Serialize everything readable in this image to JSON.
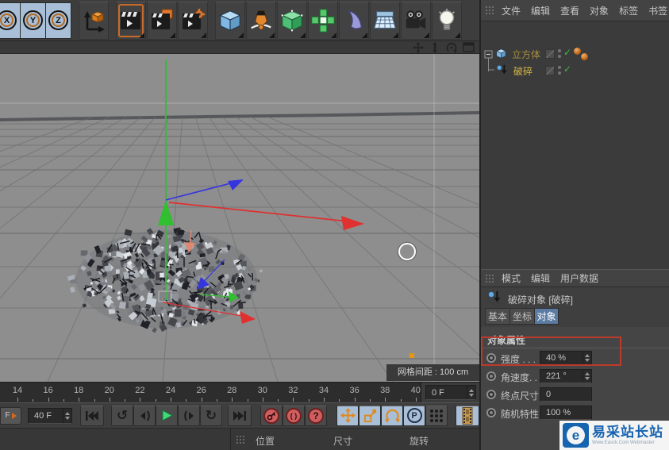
{
  "toolbar": {
    "axis_locks": [
      "X",
      "Y",
      "Z"
    ],
    "icons": [
      "coordinate-system",
      "render-view",
      "render-picture-viewer",
      "render-settings",
      "add-cube",
      "add-spline",
      "add-generator",
      "add-mograph",
      "add-deformer",
      "add-environment",
      "add-camera",
      "add-light"
    ]
  },
  "viewport": {
    "controls": [
      "camera-pan",
      "camera-zoom",
      "camera-rotate",
      "view-toggle"
    ],
    "grid_label": "网格间距 : 100 cm",
    "axis_colors": {
      "x": "#e03030",
      "y": "#2fbf2f",
      "z": "#3535e0"
    }
  },
  "scene": {
    "debris": {
      "count": 380,
      "slivers": 90,
      "seed": 7,
      "palette": [
        "#202228",
        "#33353b",
        "#45474d",
        "#55575d",
        "#66686e",
        "#7a7c82",
        "#8f9298",
        "#aab0b6",
        "#c8cdd3",
        "#e2e6ea"
      ]
    }
  },
  "timeline": {
    "tick_labels": [
      "14",
      "16",
      "18",
      "20",
      "22",
      "24",
      "26",
      "28",
      "30",
      "32",
      "34",
      "36",
      "38",
      "40"
    ],
    "frame_display": "0 F",
    "current_frame": "40 F",
    "partial_label": "F"
  },
  "transport": {
    "icons": [
      "goto-start",
      "prev-key",
      "prev-frame",
      "play",
      "next-frame",
      "next-key",
      "goto-end",
      "record-key",
      "autokey",
      "keyframe-question",
      "move-tool",
      "scale-tool",
      "rotate-tool",
      "coordinate-p",
      "keyframe-dots",
      "filmstrip"
    ],
    "paren_glyph": "( )",
    "question_glyph": "?",
    "p_glyph": "P"
  },
  "coordinate_bar": {
    "position_label": "位置",
    "size_label": "尺寸",
    "rotation_label": "旋转"
  },
  "object_manager": {
    "menu": [
      "文件",
      "编辑",
      "查看",
      "对象",
      "标签",
      "书签"
    ],
    "objects": [
      {
        "name": "立方体",
        "enabled": true,
        "tags": 2
      },
      {
        "name": "破碎",
        "enabled": true,
        "child": true
      }
    ]
  },
  "attribute_manager": {
    "menu": [
      "模式",
      "编辑",
      "用户数据"
    ],
    "object_title": "破碎对象 [破碎]",
    "tabs": [
      "基本",
      "坐标",
      "对象"
    ],
    "active_tab": "对象",
    "section_title": "对象属性",
    "properties": [
      {
        "label": "强度 . . .",
        "value": "40 %",
        "stepper": true
      },
      {
        "label": "角速度. .",
        "value": "221 °",
        "stepper": true
      },
      {
        "label": "终点尺寸",
        "value": "0",
        "stepper": false
      },
      {
        "label": "随机特性",
        "value": "100 %",
        "stepper": false
      }
    ],
    "annotation_color": "#bc3a2b"
  },
  "watermark": {
    "logo_letter": "e",
    "title": "易采站长站",
    "subtitle": "Www.Easck.Com Webmaster"
  }
}
